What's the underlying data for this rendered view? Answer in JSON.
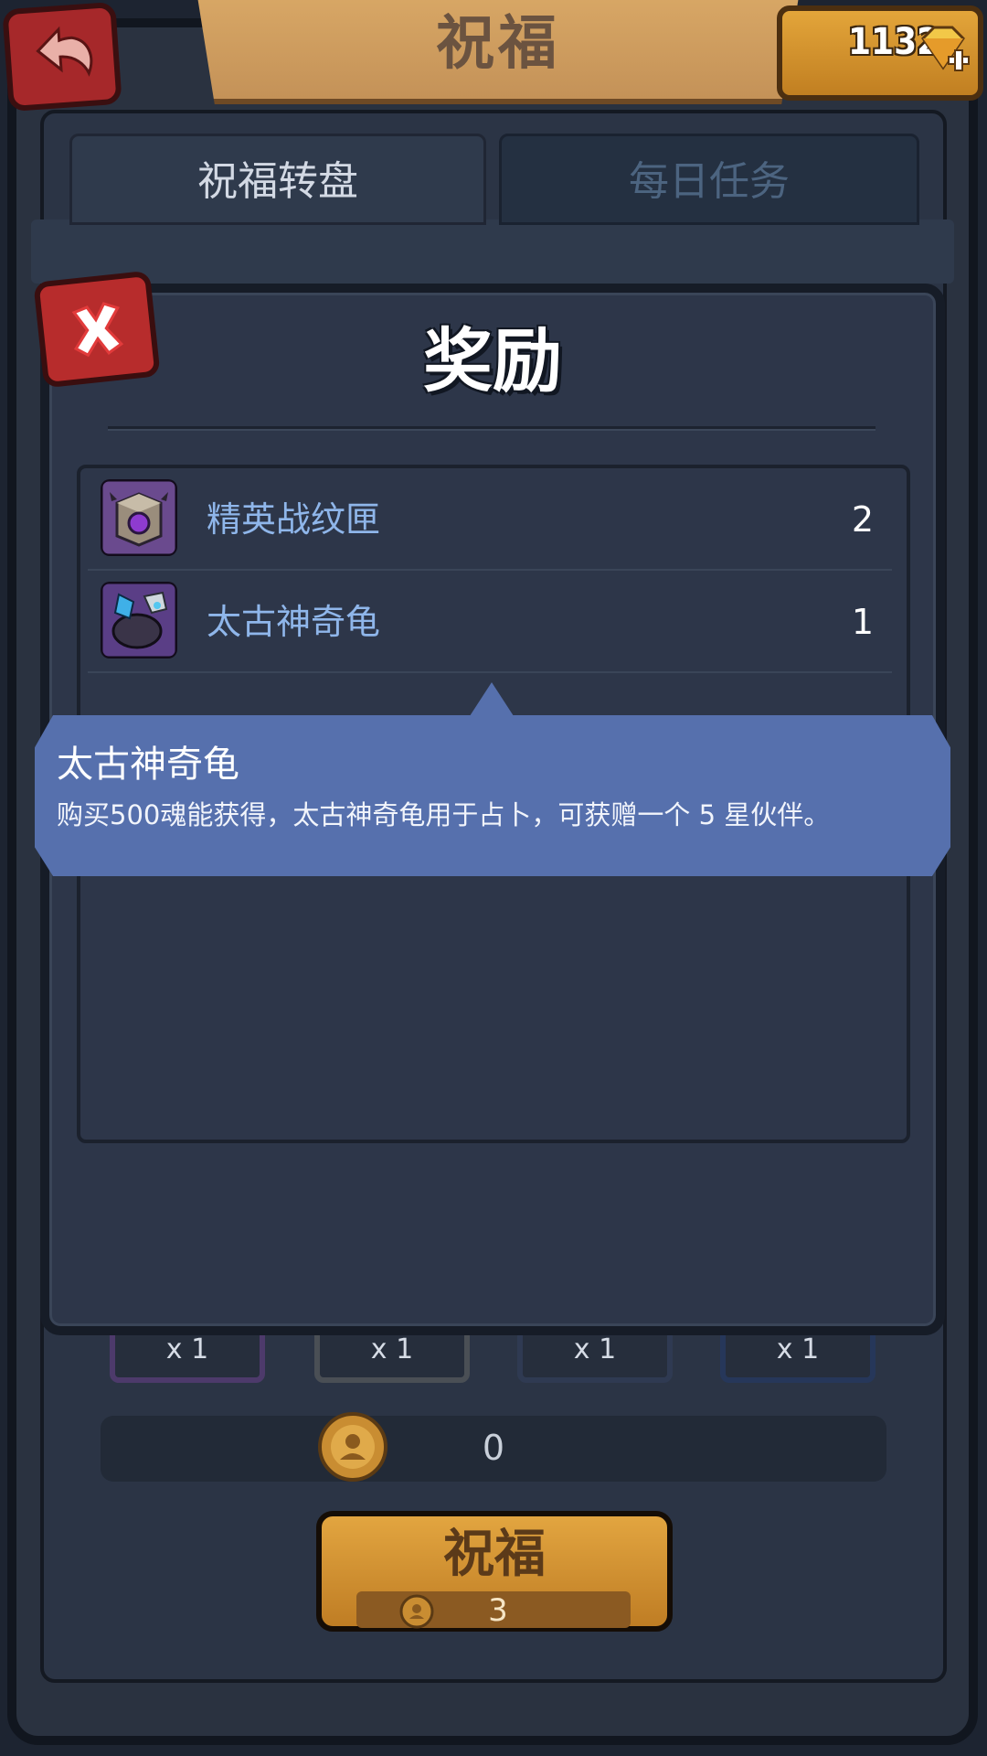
{
  "header": {
    "title": "祝福",
    "currency_value": "1132",
    "currency_icon": "gem-plus-icon"
  },
  "tabs": [
    {
      "label": "祝福转盘",
      "active": true
    },
    {
      "label": "每日任务",
      "active": false
    }
  ],
  "modal": {
    "title": "奖励",
    "close_icon": "close-x-icon",
    "rewards": [
      {
        "name": "精英战纹匣",
        "quantity": "2",
        "icon": "elite-box-icon"
      },
      {
        "name": "太古神奇龟",
        "quantity": "1",
        "icon": "ancient-turtle-icon"
      }
    ],
    "tooltip": {
      "title": "太古神奇龟",
      "description": "购买500魂能获得，太古神奇龟用于占卜，可获赠一个 5 星伙伴。"
    }
  },
  "bottom": {
    "slots": [
      "x 1",
      "x 1",
      "x 1",
      "x 1"
    ],
    "coin_value": "0",
    "bless_button": {
      "label": "祝福",
      "cost": "3"
    }
  },
  "colors": {
    "background": "#1d2431",
    "tooltip": "#5670ad",
    "reward_name": "#8fb6ea",
    "accent_gold": "#d99a36",
    "accent_red": "#b72c2c"
  }
}
